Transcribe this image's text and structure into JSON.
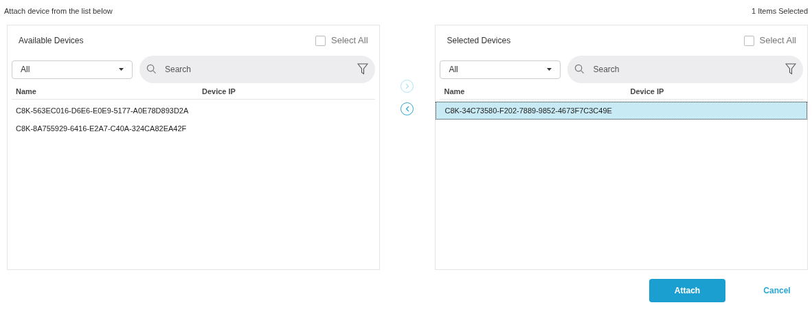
{
  "instruction": "Attach device from the list below",
  "selection_count": "1 Items Selected",
  "panels": [
    {
      "title": "Available Devices",
      "select_all": {
        "label": "Select All",
        "checked": false
      },
      "filter": {
        "value": "All"
      },
      "search": {
        "placeholder": "Search"
      },
      "columns": [
        "Name",
        "Device IP"
      ],
      "rows": [
        {
          "name": "C8K-563EC016-D6E6-E0E9-5177-A0E78D893D2A",
          "selected": false
        },
        {
          "name": "C8K-8A755929-6416-E2A7-C40A-324CA82EA42F",
          "selected": false
        }
      ]
    },
    {
      "title": "Selected Devices",
      "select_all": {
        "label": "Select All",
        "checked": false
      },
      "filter": {
        "value": "All"
      },
      "search": {
        "placeholder": "Search"
      },
      "columns": [
        "Name",
        "Device IP"
      ],
      "rows": [
        {
          "name": "C8K-34C73580-F202-7889-9852-4673F7C3C49E",
          "selected": true
        }
      ]
    }
  ],
  "transfer": [
    {
      "kind": "forward",
      "disabled": true
    },
    {
      "kind": "back",
      "disabled": false
    }
  ],
  "buttons": [
    {
      "label": "Attach",
      "kind": "primary"
    },
    {
      "label": "Cancel",
      "kind": "link"
    }
  ]
}
